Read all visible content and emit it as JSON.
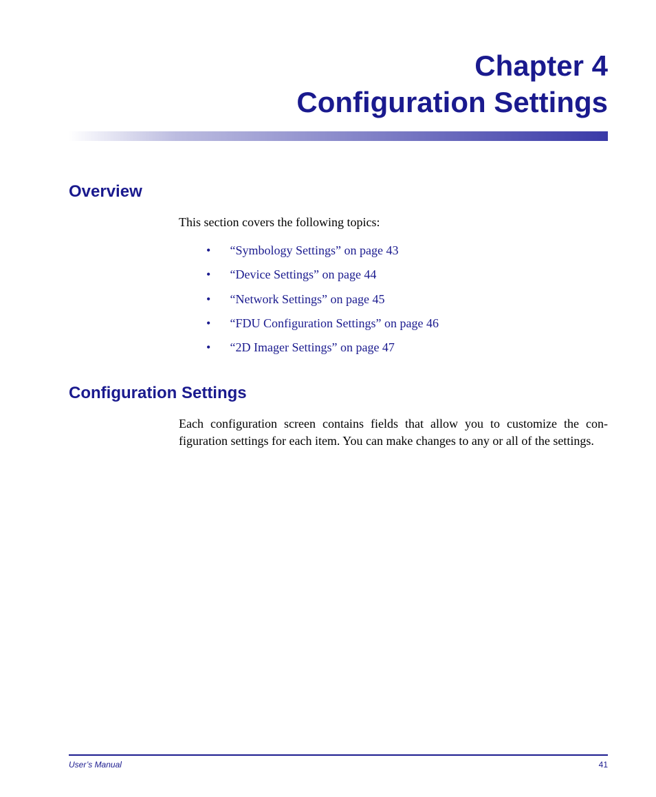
{
  "chapter": {
    "label_line1": "Chapter 4",
    "label_line2": "Configuration Settings"
  },
  "overview": {
    "heading": "Overview",
    "intro": "This section covers the following topics:",
    "topics": [
      "“Symbology Settings” on page 43",
      "“Device Settings” on page 44",
      "“Network Settings” on page 45",
      "“FDU Configuration Settings” on page 46",
      "“2D Imager Settings” on page 47"
    ]
  },
  "config": {
    "heading": "Configuration Settings",
    "body": "Each configuration screen contains fields that allow you to customize the con­figuration settings for each item. You can make changes to any or all of the set­tings."
  },
  "footer": {
    "left": "User’s Manual",
    "right": "41"
  }
}
